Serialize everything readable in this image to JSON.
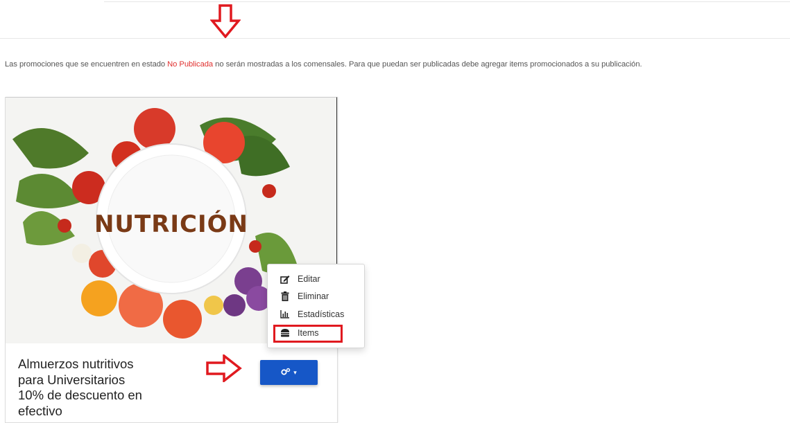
{
  "notice": {
    "before": "Las promociones que se encuentren en estado ",
    "status": "No Publicada",
    "after": " no serán mostradas a los comensales. Para que puedan ser publicadas debe agregar items promocionados a su publicación."
  },
  "promotion": {
    "image_title": "NUTRICIÓN",
    "lines": [
      "Almuerzos nutritivos",
      "para Universitarios",
      "10% de descuento en",
      "efectivo"
    ]
  },
  "actions_button": {
    "icon": "gears-icon",
    "caret": "▾"
  },
  "menu": {
    "items": [
      {
        "label": "Editar",
        "icon": "edit-icon"
      },
      {
        "label": "Eliminar",
        "icon": "trash-icon"
      },
      {
        "label": "Estadísticas",
        "icon": "chart-icon"
      },
      {
        "label": "Items",
        "icon": "burger-icon"
      }
    ]
  },
  "colors": {
    "accent": "#1657c7",
    "status_red": "#e0302f",
    "annotation_red": "#e0191f"
  }
}
